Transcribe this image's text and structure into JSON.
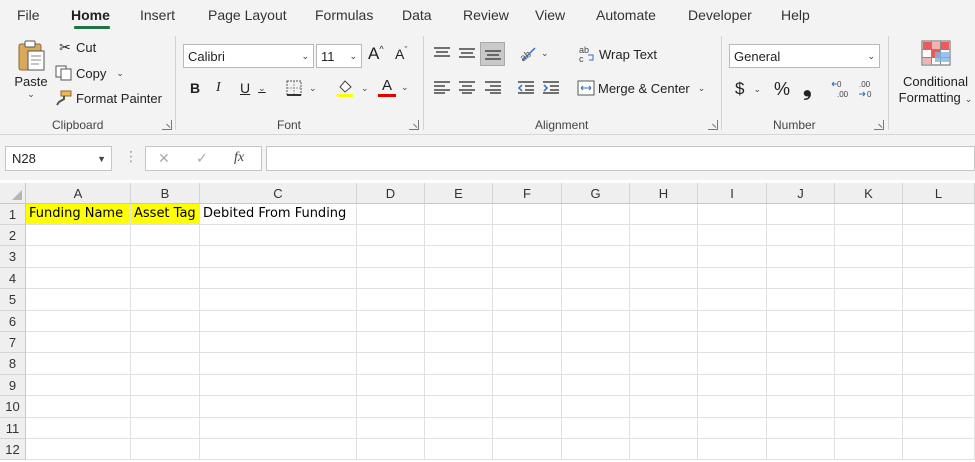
{
  "menu": {
    "tabs": [
      "File",
      "Home",
      "Insert",
      "Page Layout",
      "Formulas",
      "Data",
      "Review",
      "View",
      "Automate",
      "Developer",
      "Help"
    ],
    "active_tab": "Home"
  },
  "clipboard": {
    "paste_label": "Paste",
    "cut_label": "Cut",
    "copy_label": "Copy",
    "format_painter_label": "Format Painter",
    "group_label": "Clipboard"
  },
  "font": {
    "family": "Calibri",
    "size": "11",
    "bold": "B",
    "italic": "I",
    "underline": "U",
    "grow": "A",
    "shrink": "A",
    "font_color_letter": "A",
    "group_label": "Font",
    "highlight_color": "#ffff00",
    "font_color": "#e00000"
  },
  "alignment": {
    "wrap_text_label": "Wrap Text",
    "merge_center_label": "Merge & Center",
    "group_label": "Alignment"
  },
  "number": {
    "format": "General",
    "currency_symbol": "$",
    "percent_symbol": "%",
    "comma_symbol": "❟",
    "increase_decimal": "←.0 .00",
    "decrease_decimal": ".00 →.0",
    "group_label": "Number"
  },
  "styles": {
    "conditional_label_1": "Conditional",
    "conditional_label_2": "Formatting"
  },
  "formula_bar": {
    "name_box": "N28",
    "cancel": "✕",
    "enter": "✓",
    "fx": "fx",
    "formula": ""
  },
  "sheet": {
    "columns": [
      "A",
      "B",
      "C",
      "D",
      "E",
      "F",
      "G",
      "H",
      "I",
      "J",
      "K",
      "L"
    ],
    "rows": [
      "1",
      "2",
      "3",
      "4",
      "5",
      "6",
      "7",
      "8",
      "9",
      "10",
      "11",
      "12"
    ],
    "cells": {
      "A1": "Funding Name",
      "B1": "Asset Tag",
      "C1": "Debited From Funding"
    },
    "highlight_color": "#ffff00",
    "accent": "#217346"
  }
}
